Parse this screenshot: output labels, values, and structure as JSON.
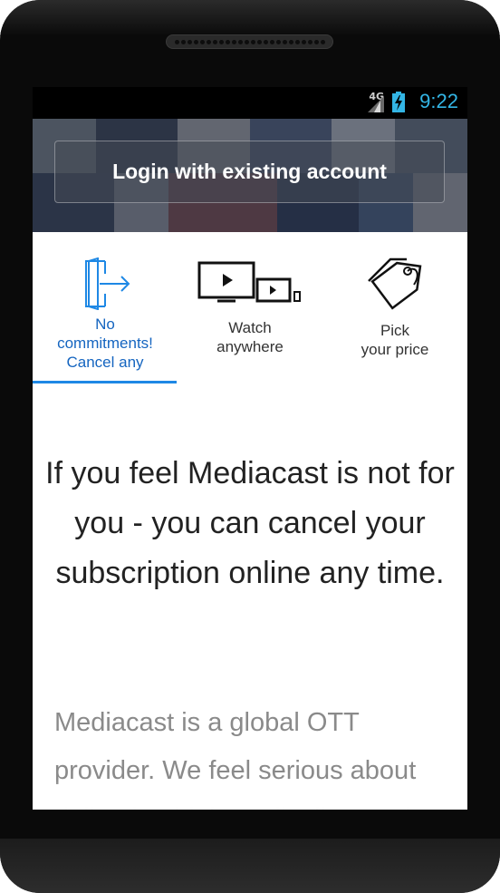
{
  "status_bar": {
    "network": "4G",
    "time": "9:22",
    "time_color": "#33b5e5"
  },
  "hero": {
    "login_label": "Login with existing account"
  },
  "tabs": [
    {
      "label_lines": [
        "No",
        "commitments!",
        "Cancel any"
      ],
      "icon": "door-exit-icon",
      "active": true
    },
    {
      "label_lines": [
        "Watch",
        "anywhere"
      ],
      "icon": "devices-icon",
      "active": false
    },
    {
      "label_lines": [
        "Pick",
        "your price"
      ],
      "icon": "price-tag-icon",
      "active": false
    }
  ],
  "main": {
    "headline": "If you feel Mediacast is not for you - you can cancel your subscription online any time.",
    "body": "Mediacast is a global OTT provider. We feel serious about delivering high quality licensed"
  },
  "colors": {
    "accent": "#1e88e5",
    "active_tab_text": "#1565c0"
  }
}
